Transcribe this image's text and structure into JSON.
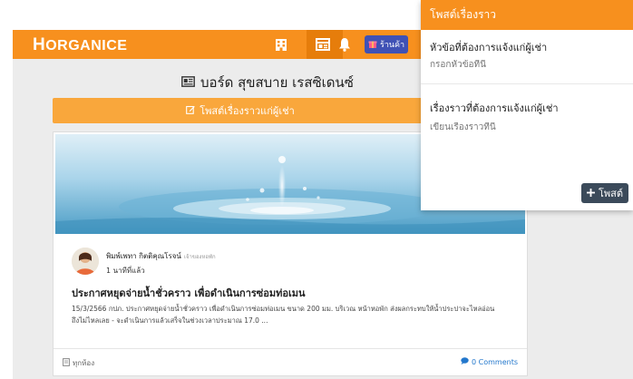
{
  "brand": {
    "prefix": "H",
    "name": "ORGANICE"
  },
  "nav": {
    "shop_label": "ร้านค้า"
  },
  "board": {
    "title": "บอร์ด สุขสบาย เรสซิเดนซ์"
  },
  "post_button": {
    "label": "โพสต์เรื่องราวแก่ผู้เช่า"
  },
  "post": {
    "author": "พิมพ์เพทา กิตติคุณโรจน์",
    "author_role": "เจ้าของหอพัก",
    "time": "1 นาทีที่แล้ว",
    "title": "ประกาศหยุดจ่ายน้ำชั่วคราว เพื่อดำเนินการซ่อมท่อเมน",
    "body": "15/3/2566 กปภ. ประกาศหยุดจ่ายน้ำชั่วคราว เพื่อดำเนินการซ่อมท่อเมน ขนาด 200 มม. บริเวณ หน้าหอพัก ส่งผลกระทบให้น้ำประปาจะไหลอ่อนถึงไม่ไหลเลย - จะดำเนินการแล้วเสร็จในช่วงเวลาประมาณ 17.0 ...",
    "room_tag": "ทุกห้อง",
    "comments": "0 Comments"
  },
  "panel": {
    "title": "โพสต์เรื่องราว",
    "subject_label": "หัวข้อที่ต้องการแจ้งแก่ผู้เช่า",
    "subject_placeholder": "กรอกหัวข้อที่นี่",
    "story_label": "เรื่องราวที่ต้องการแจ้งแก่ผู้เช่า",
    "story_placeholder": "เขียนเรื่องราวที่นี่",
    "submit_label": "โพสต์"
  },
  "colors": {
    "accent": "#f7901e",
    "button": "#f9a73c",
    "shop": "#3f51b5",
    "submit": "#3b4a5a",
    "link": "#2277cc"
  },
  "icons": [
    "building-icon",
    "board-icon",
    "bell-icon",
    "gift-icon",
    "newspaper-icon",
    "edit-icon",
    "document-icon",
    "comment-icon",
    "plus-icon"
  ]
}
